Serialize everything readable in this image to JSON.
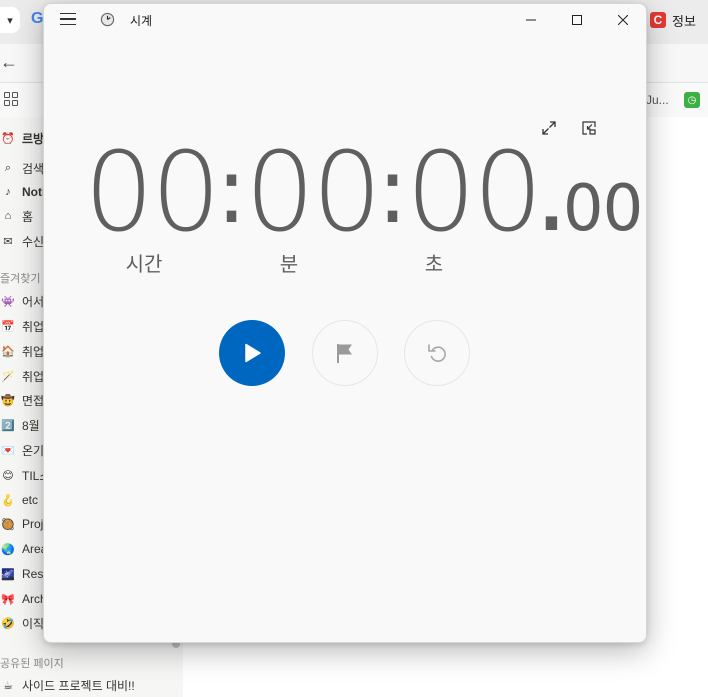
{
  "browser": {
    "right_tab_label": "정보",
    "right_tab_icon": "C",
    "bookmark_partial": "Ju...",
    "google_icon": "G"
  },
  "sidebar": {
    "top_items": [
      {
        "label": "르방",
        "icon": "clock-icon"
      },
      {
        "label": "검색",
        "icon": "search-icon"
      },
      {
        "label": "Noti",
        "icon": "bell-icon"
      },
      {
        "label": "홈",
        "icon": "home-icon"
      },
      {
        "label": "수신",
        "icon": "inbox-icon"
      }
    ],
    "favorites_heading": "즐겨찾기",
    "favorites": [
      {
        "label": "어서",
        "emoji": "👾"
      },
      {
        "label": "취업",
        "emoji": "📅"
      },
      {
        "label": "취업",
        "emoji": "🏠"
      },
      {
        "label": "취업",
        "emoji": "🪄"
      },
      {
        "label": "면접",
        "emoji": "🤠"
      },
      {
        "label": "8월",
        "emoji": "2️⃣"
      },
      {
        "label": "온기",
        "emoji": "💌"
      },
      {
        "label": "TIL스",
        "emoji": "😊"
      },
      {
        "label": "etc",
        "emoji": "🪝"
      },
      {
        "label": "Proj",
        "emoji": "🥘"
      },
      {
        "label": "Area",
        "emoji": "🌏"
      },
      {
        "label": "Reso",
        "emoji": "🌌"
      },
      {
        "label": "Arch",
        "emoji": "🎀"
      },
      {
        "label": "이직",
        "emoji": "🤣"
      }
    ],
    "shared_heading": "공유된 페이지",
    "shared_items": [
      {
        "label": "사이드 프로젝트 대비!!",
        "emoji": "☕"
      }
    ]
  },
  "clock_app": {
    "title": "시계",
    "time": {
      "hours": "00",
      "minutes": "00",
      "seconds": "00",
      "hundredths": "00",
      "separator": ":",
      "decimal": "."
    },
    "labels": {
      "hours": "시간",
      "minutes": "분",
      "seconds": "초"
    },
    "accent_color": "#0067c0"
  }
}
